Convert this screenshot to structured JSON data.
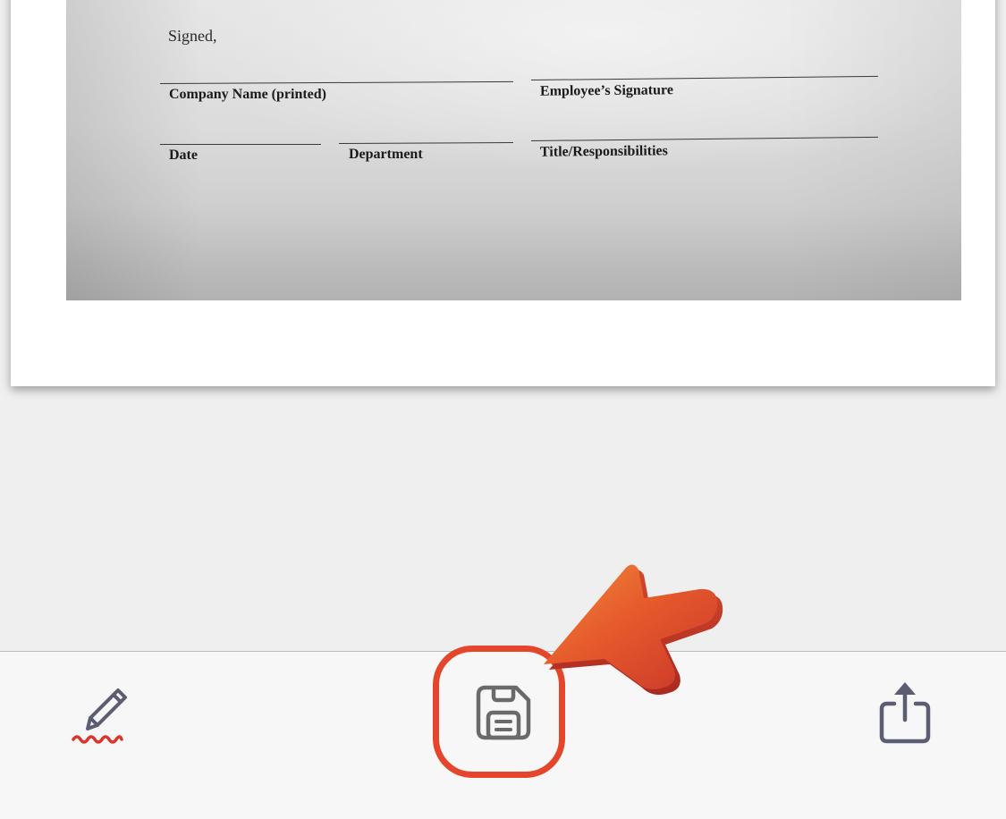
{
  "document": {
    "signed_label": "Signed,",
    "company_name_label": "Company Name (printed)",
    "employee_signature_label": "Employee’s Signature",
    "date_label": "Date",
    "department_label": "Department",
    "title_responsibilities_label": "Title/Responsibilities"
  },
  "toolbar": {
    "edit_icon": "pencil-signature-icon",
    "save_icon": "floppy-disk-save-icon",
    "share_icon": "share-upload-icon"
  },
  "annotation": {
    "highlight_color": "#e4452b",
    "arrow_color": "#e8482c"
  },
  "colors": {
    "background": "#efefef",
    "toolbar_background": "#f7f7f7",
    "icon_color": "#5b5d72",
    "squiggle_color": "#d8352b"
  }
}
